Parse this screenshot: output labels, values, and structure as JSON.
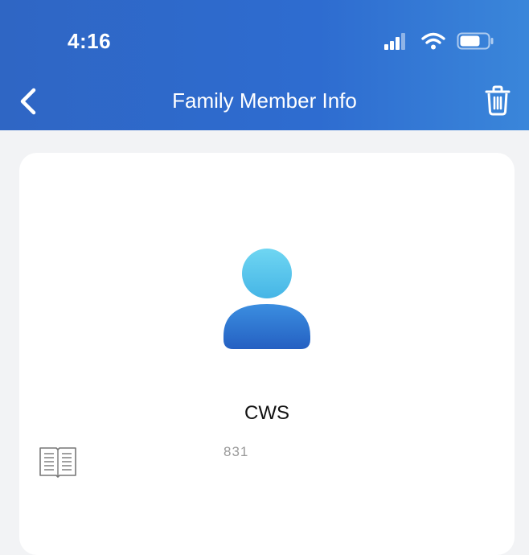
{
  "status_bar": {
    "time": "4:16",
    "icons": [
      "cellular-signal-icon",
      "wifi-icon",
      "battery-icon"
    ]
  },
  "nav": {
    "title": "Family Member Info",
    "back_icon": "chevron-left-icon",
    "delete_icon": "trash-icon"
  },
  "profile": {
    "avatar_icon": "user-avatar-icon",
    "name": "CWS",
    "phone": "831"
  },
  "side_icon": "book-icon",
  "colors": {
    "header": "#2f66c4",
    "background": "#f2f3f5",
    "avatar_head": "#58c7ec",
    "avatar_body": "#2f6fcc"
  }
}
